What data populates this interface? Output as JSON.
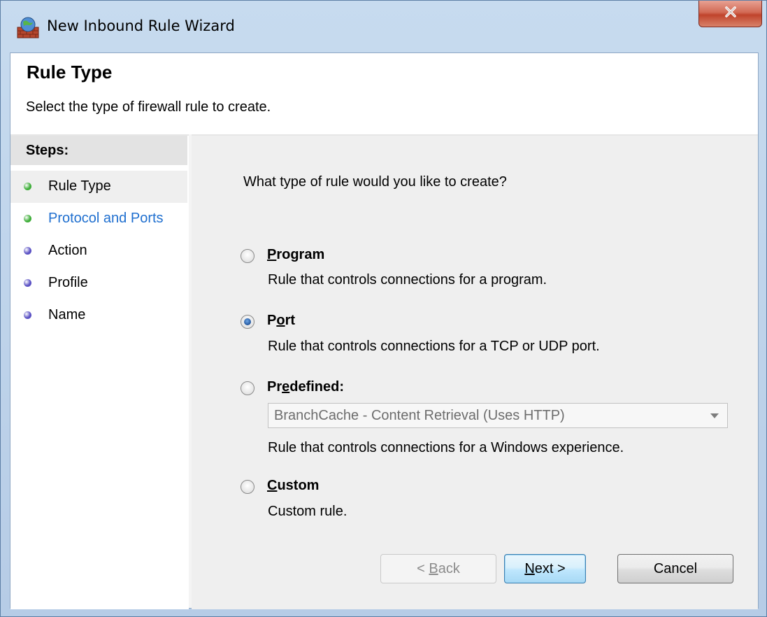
{
  "window": {
    "title": "New Inbound Rule Wizard",
    "icon": "firewall-icon",
    "close_icon": "close-icon"
  },
  "header": {
    "title": "Rule Type",
    "subtitle": "Select the type of firewall rule to create."
  },
  "steps": {
    "heading": "Steps:",
    "items": [
      {
        "label": "Rule Type",
        "state": "current",
        "dot_color": "#3fae3a"
      },
      {
        "label": "Protocol and Ports",
        "state": "link",
        "dot_color": "#3fae3a"
      },
      {
        "label": "Action",
        "state": "pending",
        "dot_color": "#5b52c4"
      },
      {
        "label": "Profile",
        "state": "pending",
        "dot_color": "#5b52c4"
      },
      {
        "label": "Name",
        "state": "pending",
        "dot_color": "#5b52c4"
      }
    ]
  },
  "content": {
    "question": "What type of rule would you like to create?",
    "options": [
      {
        "key": "P",
        "rest": "rogram",
        "label": "Program",
        "description": "Rule that controls connections for a program.",
        "selected": false
      },
      {
        "key": "o",
        "pre": "P",
        "rest": "rt",
        "label": "Port",
        "description": "Rule that controls connections for a TCP or UDP port.",
        "selected": true
      },
      {
        "pre": "Pr",
        "key": "e",
        "rest": "defined:",
        "label": "Predefined:",
        "description": "Rule that controls connections for a Windows experience.",
        "selected": false
      },
      {
        "key": "C",
        "rest": "ustom",
        "label": "Custom",
        "description": "Custom rule.",
        "selected": false
      }
    ],
    "predefined_select": {
      "value": "BranchCache - Content Retrieval (Uses HTTP)",
      "enabled": false
    }
  },
  "buttons": {
    "back": {
      "pre": "< ",
      "key": "B",
      "rest": "ack",
      "enabled": false
    },
    "next": {
      "key": "N",
      "rest": "ext >",
      "enabled": true
    },
    "cancel": {
      "label": "Cancel",
      "enabled": true
    }
  },
  "colors": {
    "accent_link": "#1f6fcf",
    "step_done": "#3fae3a",
    "step_pending": "#5b52c4"
  }
}
